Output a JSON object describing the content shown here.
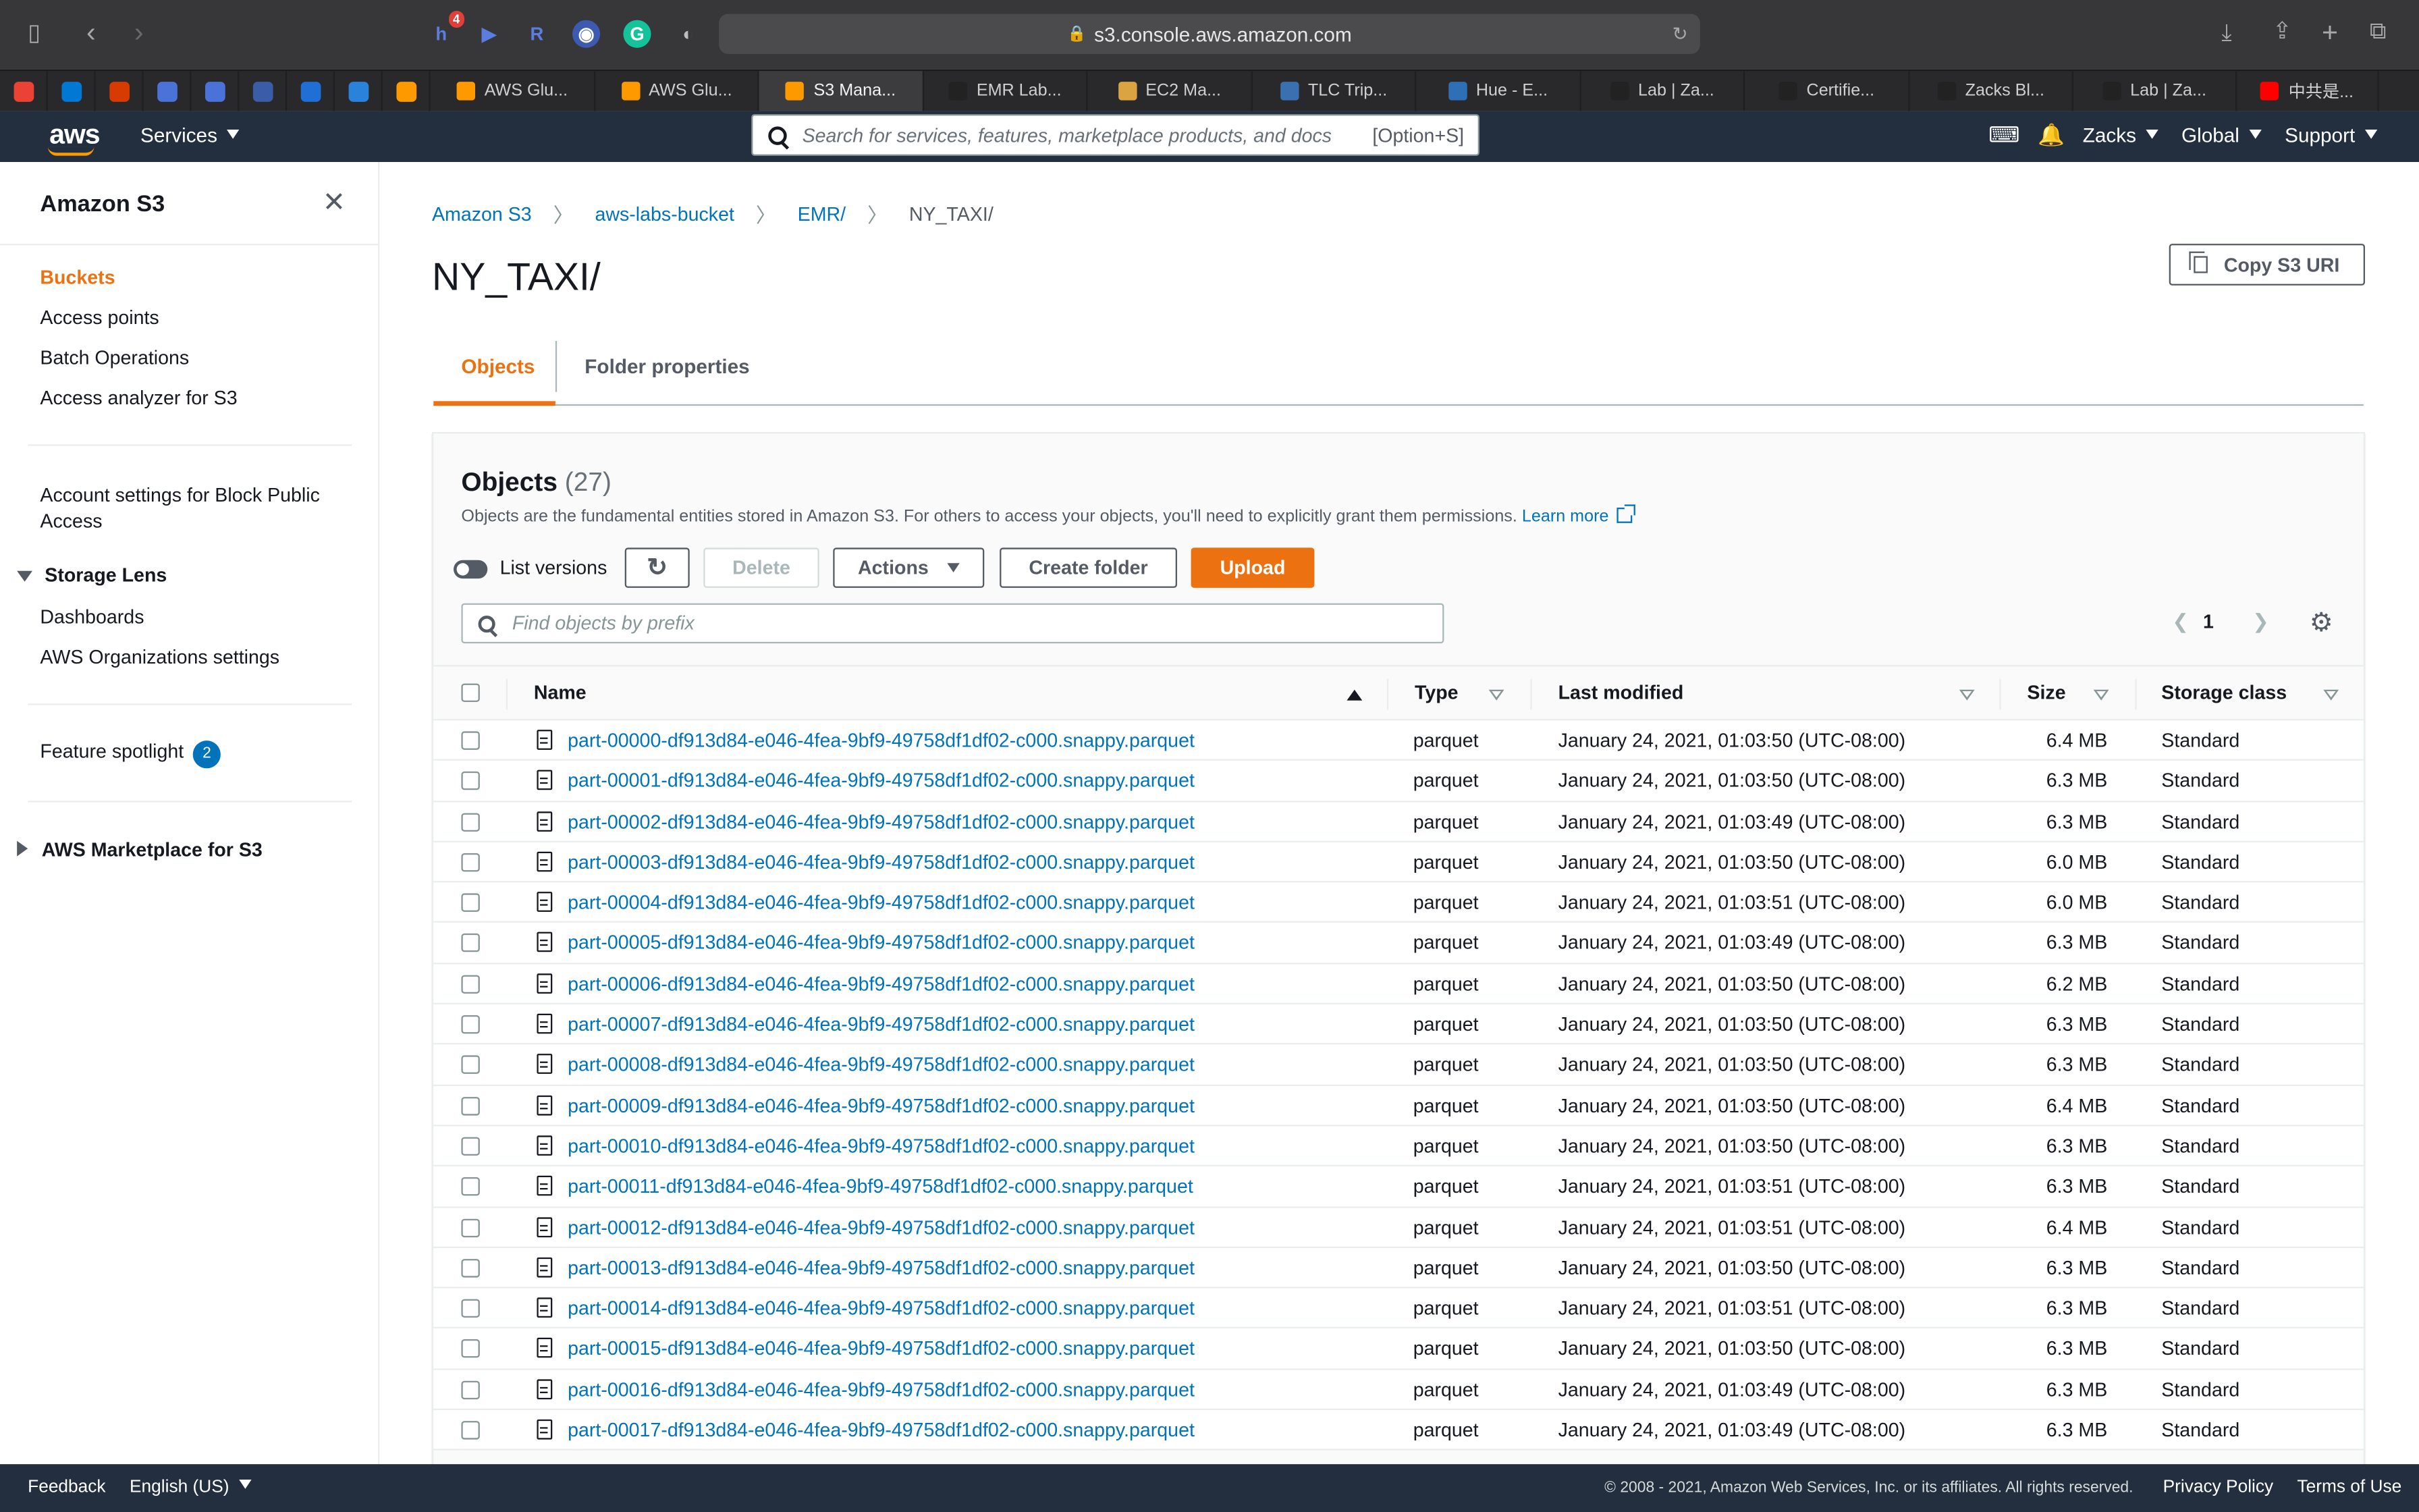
{
  "browser": {
    "url": "s3.console.aws.amazon.com",
    "extension_badge": "4",
    "tabs": [
      {
        "label": "AWS Glu...",
        "icon_color": "#ff9900"
      },
      {
        "label": "AWS Glu...",
        "icon_color": "#ff9900"
      },
      {
        "label": "S3 Mana...",
        "icon_color": "#ff9900",
        "active": true
      },
      {
        "label": "EMR Lab...",
        "icon_color": "#222222"
      },
      {
        "label": "EC2 Ma...",
        "icon_color": "#d9a441"
      },
      {
        "label": "TLC Trip...",
        "icon_color": "#3a6fb0"
      },
      {
        "label": "Hue - E...",
        "icon_color": "#2f6fb5"
      },
      {
        "label": "Lab | Za...",
        "icon_color": "#222222"
      },
      {
        "label": "Certifie...",
        "icon_color": "#222222"
      },
      {
        "label": "Zacks Bl...",
        "icon_color": "#222222"
      },
      {
        "label": "Lab | Za...",
        "icon_color": "#222222"
      },
      {
        "label": "中共是...",
        "icon_color": "#ff0000"
      }
    ]
  },
  "aws_nav": {
    "logo": "aws",
    "services": "Services",
    "search_placeholder": "Search for services, features, marketplace products, and docs",
    "search_shortcut": "[Option+S]",
    "user": "Zacks",
    "region": "Global",
    "support": "Support"
  },
  "sidebar": {
    "title": "Amazon S3",
    "links": [
      "Buckets",
      "Access points",
      "Batch Operations",
      "Access analyzer for S3"
    ],
    "block_public": "Account settings for Block Public Access",
    "storage_lens": "Storage Lens",
    "storage_lens_items": [
      "Dashboards",
      "AWS Organizations settings"
    ],
    "feature_spotlight": "Feature spotlight",
    "feature_spotlight_count": "2",
    "marketplace": "AWS Marketplace for S3"
  },
  "breadcrumb": [
    "Amazon S3",
    "aws-labs-bucket",
    "EMR/",
    "NY_TAXI/"
  ],
  "page": {
    "title": "NY_TAXI/",
    "copy_uri": "Copy S3 URI",
    "tabs": [
      "Objects",
      "Folder properties"
    ]
  },
  "objects": {
    "title": "Objects",
    "count": "(27)",
    "description": "Objects are the fundamental entities stored in Amazon S3. For others to access your objects, you'll need to explicitly grant them permissions.",
    "learn_more": "Learn more",
    "list_versions": "List versions",
    "delete": "Delete",
    "actions": "Actions",
    "create_folder": "Create folder",
    "upload": "Upload",
    "filter_placeholder": "Find objects by prefix",
    "page": "1",
    "columns": [
      "Name",
      "Type",
      "Last modified",
      "Size",
      "Storage class"
    ],
    "rows": [
      {
        "name": "part-00000-df913d84-e046-4fea-9bf9-49758df1df02-c000.snappy.parquet",
        "type": "parquet",
        "modified": "January 24, 2021, 01:03:50 (UTC-08:00)",
        "size": "6.4 MB",
        "class": "Standard"
      },
      {
        "name": "part-00001-df913d84-e046-4fea-9bf9-49758df1df02-c000.snappy.parquet",
        "type": "parquet",
        "modified": "January 24, 2021, 01:03:50 (UTC-08:00)",
        "size": "6.3 MB",
        "class": "Standard"
      },
      {
        "name": "part-00002-df913d84-e046-4fea-9bf9-49758df1df02-c000.snappy.parquet",
        "type": "parquet",
        "modified": "January 24, 2021, 01:03:49 (UTC-08:00)",
        "size": "6.3 MB",
        "class": "Standard"
      },
      {
        "name": "part-00003-df913d84-e046-4fea-9bf9-49758df1df02-c000.snappy.parquet",
        "type": "parquet",
        "modified": "January 24, 2021, 01:03:50 (UTC-08:00)",
        "size": "6.0 MB",
        "class": "Standard"
      },
      {
        "name": "part-00004-df913d84-e046-4fea-9bf9-49758df1df02-c000.snappy.parquet",
        "type": "parquet",
        "modified": "January 24, 2021, 01:03:51 (UTC-08:00)",
        "size": "6.0 MB",
        "class": "Standard"
      },
      {
        "name": "part-00005-df913d84-e046-4fea-9bf9-49758df1df02-c000.snappy.parquet",
        "type": "parquet",
        "modified": "January 24, 2021, 01:03:49 (UTC-08:00)",
        "size": "6.3 MB",
        "class": "Standard"
      },
      {
        "name": "part-00006-df913d84-e046-4fea-9bf9-49758df1df02-c000.snappy.parquet",
        "type": "parquet",
        "modified": "January 24, 2021, 01:03:50 (UTC-08:00)",
        "size": "6.2 MB",
        "class": "Standard"
      },
      {
        "name": "part-00007-df913d84-e046-4fea-9bf9-49758df1df02-c000.snappy.parquet",
        "type": "parquet",
        "modified": "January 24, 2021, 01:03:50 (UTC-08:00)",
        "size": "6.3 MB",
        "class": "Standard"
      },
      {
        "name": "part-00008-df913d84-e046-4fea-9bf9-49758df1df02-c000.snappy.parquet",
        "type": "parquet",
        "modified": "January 24, 2021, 01:03:50 (UTC-08:00)",
        "size": "6.3 MB",
        "class": "Standard"
      },
      {
        "name": "part-00009-df913d84-e046-4fea-9bf9-49758df1df02-c000.snappy.parquet",
        "type": "parquet",
        "modified": "January 24, 2021, 01:03:50 (UTC-08:00)",
        "size": "6.4 MB",
        "class": "Standard"
      },
      {
        "name": "part-00010-df913d84-e046-4fea-9bf9-49758df1df02-c000.snappy.parquet",
        "type": "parquet",
        "modified": "January 24, 2021, 01:03:50 (UTC-08:00)",
        "size": "6.3 MB",
        "class": "Standard"
      },
      {
        "name": "part-00011-df913d84-e046-4fea-9bf9-49758df1df02-c000.snappy.parquet",
        "type": "parquet",
        "modified": "January 24, 2021, 01:03:51 (UTC-08:00)",
        "size": "6.3 MB",
        "class": "Standard"
      },
      {
        "name": "part-00012-df913d84-e046-4fea-9bf9-49758df1df02-c000.snappy.parquet",
        "type": "parquet",
        "modified": "January 24, 2021, 01:03:51 (UTC-08:00)",
        "size": "6.4 MB",
        "class": "Standard"
      },
      {
        "name": "part-00013-df913d84-e046-4fea-9bf9-49758df1df02-c000.snappy.parquet",
        "type": "parquet",
        "modified": "January 24, 2021, 01:03:50 (UTC-08:00)",
        "size": "6.3 MB",
        "class": "Standard"
      },
      {
        "name": "part-00014-df913d84-e046-4fea-9bf9-49758df1df02-c000.snappy.parquet",
        "type": "parquet",
        "modified": "January 24, 2021, 01:03:51 (UTC-08:00)",
        "size": "6.3 MB",
        "class": "Standard"
      },
      {
        "name": "part-00015-df913d84-e046-4fea-9bf9-49758df1df02-c000.snappy.parquet",
        "type": "parquet",
        "modified": "January 24, 2021, 01:03:50 (UTC-08:00)",
        "size": "6.3 MB",
        "class": "Standard"
      },
      {
        "name": "part-00016-df913d84-e046-4fea-9bf9-49758df1df02-c000.snappy.parquet",
        "type": "parquet",
        "modified": "January 24, 2021, 01:03:49 (UTC-08:00)",
        "size": "6.3 MB",
        "class": "Standard"
      },
      {
        "name": "part-00017-df913d84-e046-4fea-9bf9-49758df1df02-c000.snappy.parquet",
        "type": "parquet",
        "modified": "January 24, 2021, 01:03:49 (UTC-08:00)",
        "size": "6.3 MB",
        "class": "Standard"
      }
    ]
  },
  "footer": {
    "feedback": "Feedback",
    "language": "English (US)",
    "copyright": "© 2008 - 2021, Amazon Web Services, Inc. or its affiliates. All rights reserved.",
    "privacy": "Privacy Policy",
    "terms": "Terms of Use"
  },
  "colors": {
    "aws_nav": "#232f3e",
    "accent_orange": "#ec7211",
    "link_blue": "#0073bb"
  }
}
